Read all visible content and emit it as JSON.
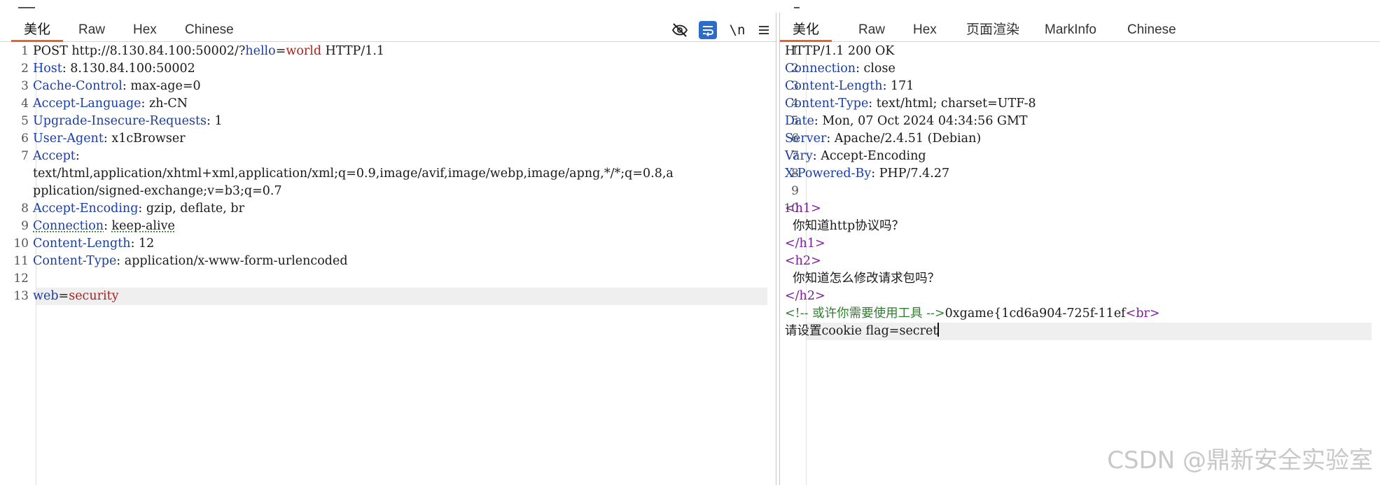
{
  "request": {
    "tabs": [
      "美化",
      "Raw",
      "Hex",
      "Chinese"
    ],
    "active_tab": 0,
    "toolbar": {
      "hide_icon": "eye-slash-icon",
      "wrap_icon": "word-wrap-icon",
      "newline_label": "\\n",
      "menu_icon": "hamburger-menu-icon",
      "wrap_active_color": "#2b6bc9"
    },
    "lines": [
      {
        "n": "1",
        "method": "POST",
        "url_base": " http://8.130.84.100:50002/?",
        "param_key": "hello",
        "eq": "=",
        "param_val": "world",
        "proto": " HTTP/1.1"
      },
      {
        "n": "2",
        "key": "Host",
        "sep": ": ",
        "val": "8.130.84.100:50002"
      },
      {
        "n": "3",
        "key": "Cache-Control",
        "sep": ": ",
        "val": "max-age=0"
      },
      {
        "n": "4",
        "key": "Accept-Language",
        "sep": ": ",
        "val": "zh-CN"
      },
      {
        "n": "5",
        "key": "Upgrade-Insecure-Requests",
        "sep": ": ",
        "val": "1"
      },
      {
        "n": "6",
        "key": "User-Agent",
        "sep": ": ",
        "val": "x1cBrowser"
      },
      {
        "n": "7",
        "key": "Accept",
        "sep": ":",
        "val": ""
      },
      {
        "n": "",
        "val": "text/html,application/xhtml+xml,application/xml;q=0.9,image/avif,image/webp,image/apng,*/*;q=0.8,a"
      },
      {
        "n": "",
        "val": "pplication/signed-exchange;v=b3;q=0.7"
      },
      {
        "n": "8",
        "key": "Accept-Encoding",
        "sep": ": ",
        "val": "gzip, deflate, br"
      },
      {
        "n": "9",
        "key": "Connection",
        "sep": ": ",
        "val": "keep-alive"
      },
      {
        "n": "10",
        "key": "Content-Length",
        "sep": ": ",
        "val": "12"
      },
      {
        "n": "11",
        "key": "Content-Type",
        "sep": ": ",
        "val": "application/x-www-form-urlencoded"
      },
      {
        "n": "12",
        "val": ""
      },
      {
        "n": "13",
        "body_key": "web",
        "eq": "=",
        "body_val": "security"
      }
    ]
  },
  "response": {
    "tabs": [
      "美化",
      "Raw",
      "Hex",
      "页面渲染",
      "MarkInfo",
      "Chinese"
    ],
    "active_tab": 0,
    "lines": [
      {
        "n": "1",
        "val": "HTTP/1.1 200 OK"
      },
      {
        "n": "2",
        "key": "Connection",
        "sep": ": ",
        "val": "close"
      },
      {
        "n": "3",
        "key": "Content-Length",
        "sep": ": ",
        "val": "171"
      },
      {
        "n": "4",
        "key": "Content-Type",
        "sep": ": ",
        "val": "text/html; charset=UTF-8"
      },
      {
        "n": "5",
        "key": "Date",
        "sep": ": ",
        "val": "Mon, 07 Oct 2024 04:34:56 GMT"
      },
      {
        "n": "6",
        "key": "Server",
        "sep": ": ",
        "val": "Apache/2.4.51 (Debian)"
      },
      {
        "n": "7",
        "key": "Vary",
        "sep": ": ",
        "val": "Accept-Encoding"
      },
      {
        "n": "8",
        "key": "X-Powered-By",
        "sep": ": ",
        "val": "PHP/7.4.27"
      },
      {
        "n": "9",
        "val": ""
      },
      {
        "n": "10",
        "tag": "<h1>"
      },
      {
        "n": "",
        "text": "  你知道http协议吗？"
      },
      {
        "n": "",
        "tag": "</h1>"
      },
      {
        "n": "",
        "tag": "<h2>"
      },
      {
        "n": "",
        "text": "  你知道怎么修改请求包吗？"
      },
      {
        "n": "",
        "tag": "</h2>"
      },
      {
        "n": "",
        "comment": "<!-- 或许你需要使用工具 -->",
        "text": "0xgame{1cd6a904-725f-11ef",
        "tag": "<br>"
      },
      {
        "n": "",
        "text": "请设置cookie flag=secret"
      }
    ]
  },
  "watermark": "CSDN @鼎新安全实验室"
}
